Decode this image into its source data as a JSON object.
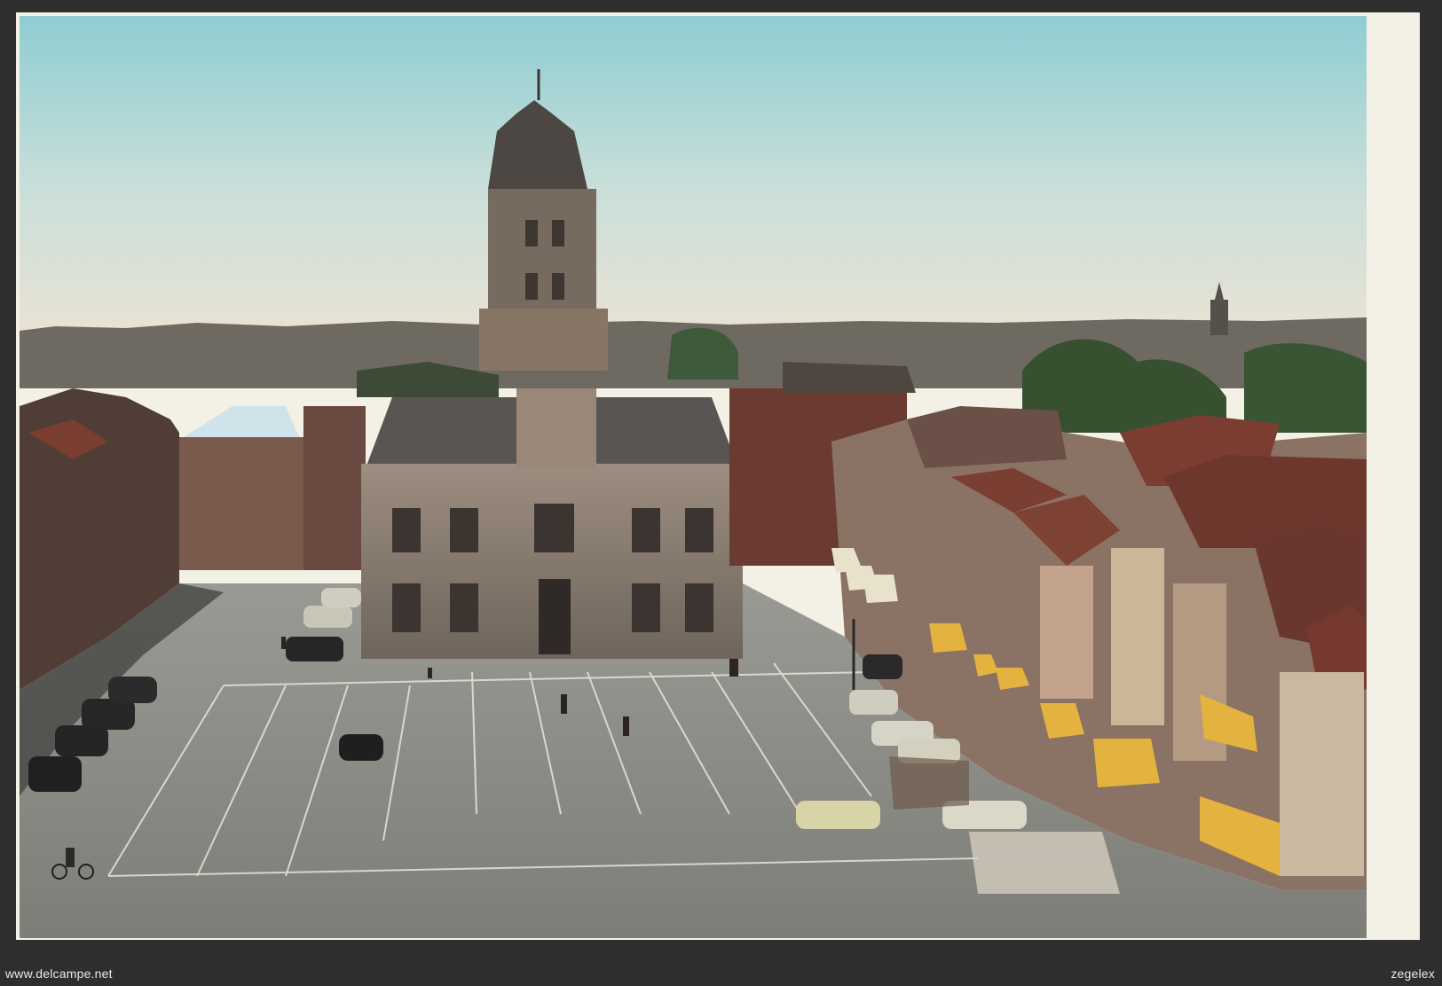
{
  "image": {
    "subject": "Vintage hand-tinted postcard of a market square with a town hall",
    "colors": {
      "sky": "#9fd3d6",
      "sky_haze": "#e7e1d3",
      "paving": "#8d8d87",
      "awning": "#e7b43c",
      "border": "#f3f0e6",
      "background": "#2e2e2e"
    }
  },
  "watermarks": {
    "left": "www.delcampe.net",
    "right": "zegelex"
  }
}
